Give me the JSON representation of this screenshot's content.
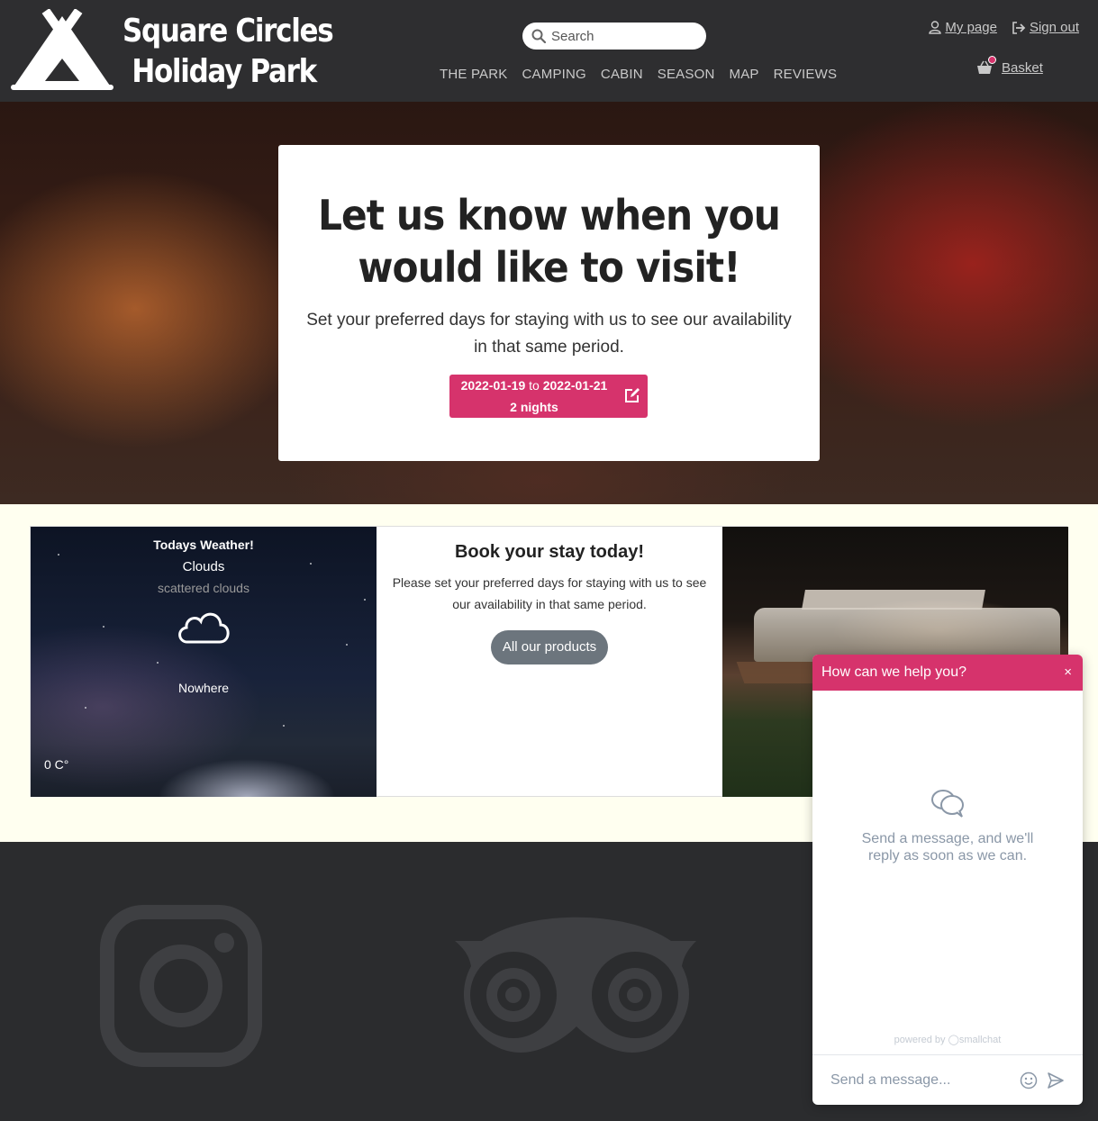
{
  "header": {
    "logo_line1": "Square Circles",
    "logo_line2": "Holiday Park",
    "search_placeholder": "Search",
    "nav": [
      "THE PARK",
      "CAMPING",
      "CABIN",
      "SEASON",
      "MAP",
      "REVIEWS"
    ],
    "my_page": "My page",
    "sign_out": "Sign out",
    "basket": "Basket"
  },
  "hero": {
    "title_line1": "Let us know when you",
    "title_line2": "would like to visit!",
    "subtitle": "Set your preferred days for staying with us to see our availability in that same period.",
    "date_from": "2022-01-19",
    "date_sep": "to",
    "date_to": "2022-01-21",
    "nights": "2 nights"
  },
  "weather": {
    "title": "Todays Weather!",
    "main": "Clouds",
    "description": "scattered clouds",
    "place": "Nowhere",
    "temp": "0 C°"
  },
  "book": {
    "title": "Book your stay today!",
    "text": "Please set your preferred days for staying with us to see our availability in that same period.",
    "button": "All our products"
  },
  "chat": {
    "header": "How can we help you?",
    "close": "×",
    "empty": "Send a message, and we'll reply as soon as we can.",
    "powered": "powered by ◯smallchat",
    "placeholder": "Send a message..."
  },
  "colors": {
    "accent": "#d6336c",
    "header_bg": "#2e2e30",
    "band_bg": "#fffff0",
    "secondary_button": "#6c757d"
  }
}
